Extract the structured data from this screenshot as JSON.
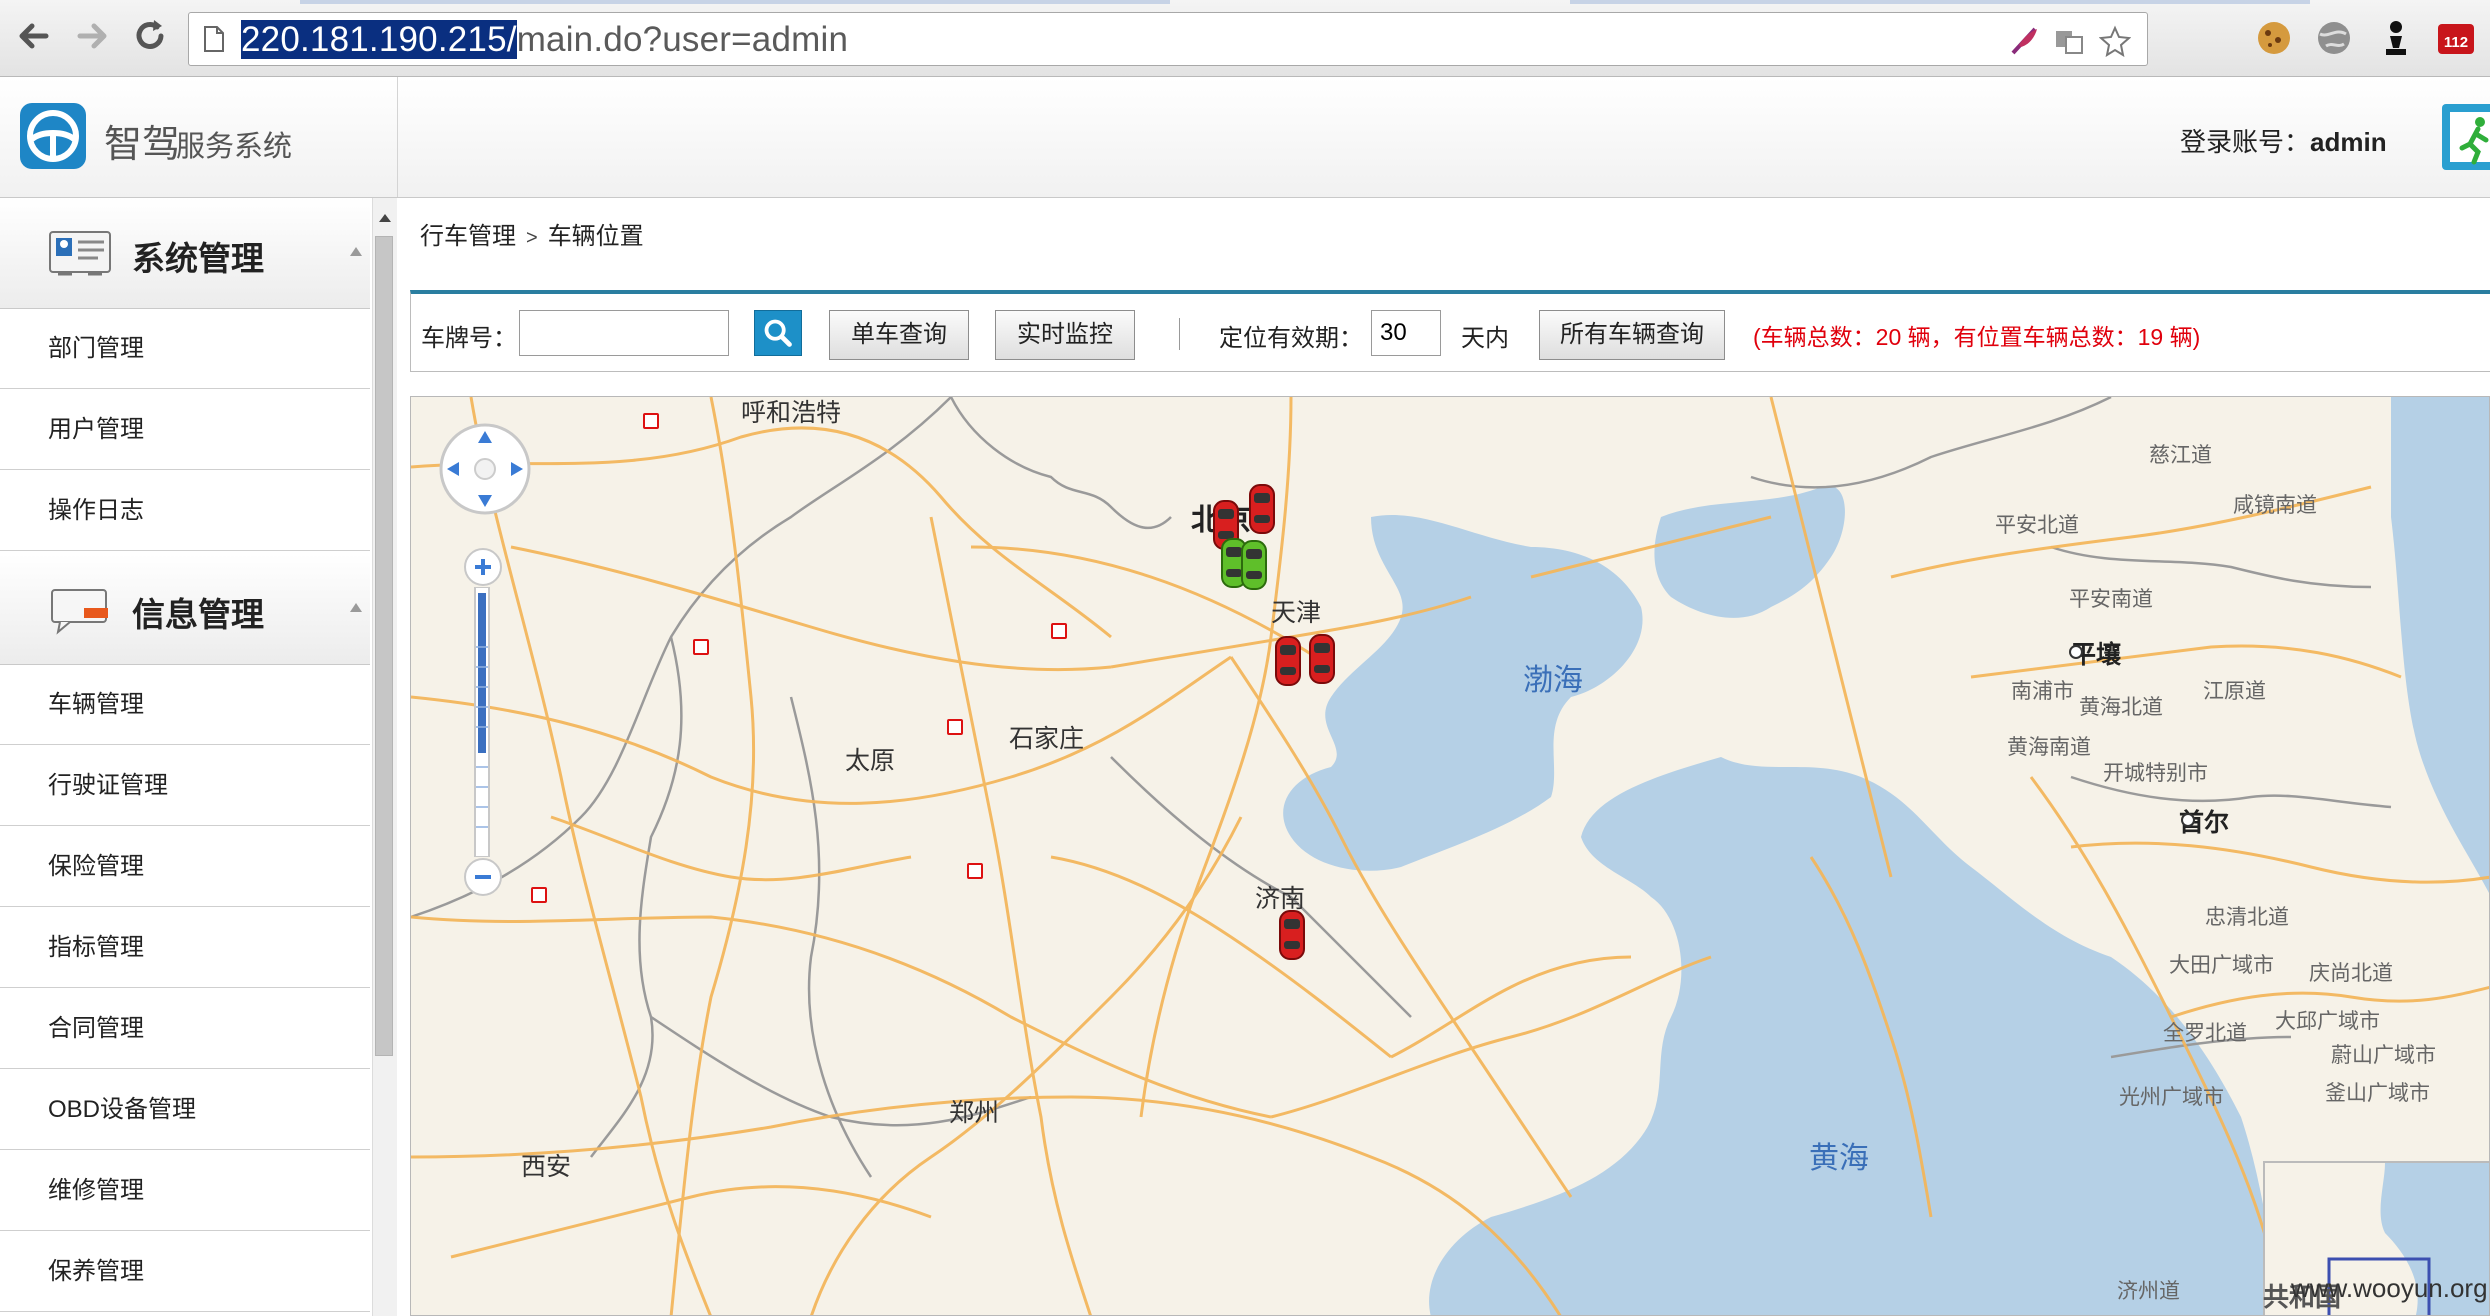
{
  "browser": {
    "url_host": "220.181.190.215/",
    "url_path": "main.do?user=admin"
  },
  "header": {
    "app_name_main": "智驾",
    "app_name_sub": "服务系统",
    "login_label": "登录账号：",
    "login_user": "admin"
  },
  "sidebar": {
    "sections": [
      {
        "title": "系统管理",
        "items": [
          "部门管理",
          "用户管理",
          "操作日志"
        ]
      },
      {
        "title": "信息管理",
        "items": [
          "车辆管理",
          "行驶证管理",
          "保险管理",
          "指标管理",
          "合同管理",
          "OBD设备管理",
          "维修管理",
          "保养管理"
        ]
      }
    ]
  },
  "breadcrumb": {
    "parent": "行车管理",
    "separator": ">",
    "current": "车辆位置"
  },
  "query": {
    "plate_label": "车牌号：",
    "plate_value": "",
    "single_query_btn": "单车查询",
    "realtime_btn": "实时监控",
    "validity_label": "定位有效期：",
    "validity_value": "30",
    "validity_unit": "天内",
    "all_query_btn": "所有车辆查询",
    "stats_text": "(车辆总数：20 辆，有位置车辆总数：19 辆)"
  },
  "map": {
    "cities": {
      "hohhot": "呼和浩特",
      "beijing": "北京",
      "tianjin": "天津",
      "shijiazhuang": "石家庄",
      "taiyuan": "太原",
      "jinan": "济南",
      "zhengzhou": "郑州",
      "xian": "西安"
    },
    "seas": {
      "bohai": "渤海",
      "yellow": "黄海"
    },
    "korea": {
      "cijiangdao": "慈江道",
      "pyongan_n": "平安北道",
      "hamgyong_s": "咸镜南道",
      "pyongan_s": "平安南道",
      "pyongyang": "平壤",
      "nampo": "南浦市",
      "hwanghae_n": "黄海北道",
      "gangwon": "江原道",
      "hwanghae_s": "黄海南道",
      "kaesong": "开城特别市",
      "seoul": "首尔",
      "chungcheong_n": "忠清北道",
      "daejeon": "大田广域市",
      "gyeongsang_n": "庆尚北道",
      "daegu": "大邱广域市",
      "jeolla_n": "全罗北道",
      "ulsan": "蔚山广域市",
      "gwangju": "光州广域市",
      "busan": "釜山广域市",
      "jeju": "济州道",
      "republic": "共和国"
    },
    "watermark": "www.wooyun.org"
  },
  "colors": {
    "accent": "#2a7ea0",
    "stats": "#e0000c",
    "sea": "#b5d0e6",
    "land": "#f6f2e8",
    "road": "#f3b65c"
  }
}
